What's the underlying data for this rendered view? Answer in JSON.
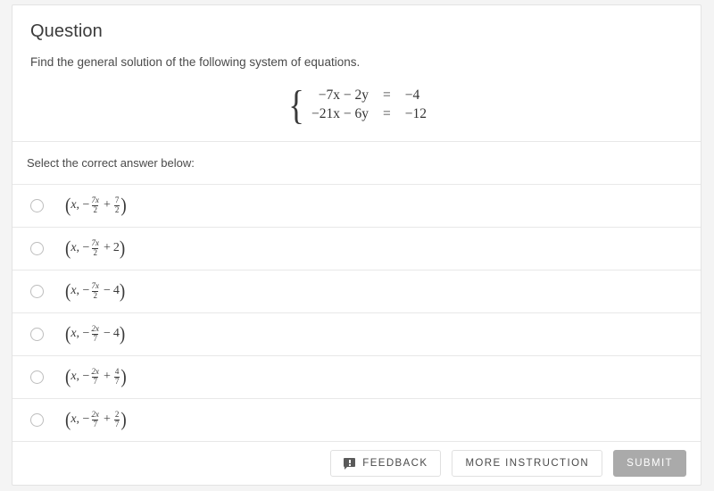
{
  "card": {
    "title": "Question",
    "prompt": "Find the general solution of the following system of equations.",
    "equations": [
      {
        "lhs": "−7x − 2y",
        "rel": "=",
        "rhs": "−4"
      },
      {
        "lhs": "−21x − 6y",
        "rel": "=",
        "rhs": "−12"
      }
    ],
    "select_prompt": "Select the correct answer below:",
    "options": [
      {
        "id": "option-1",
        "text": "(x, −7x/2 + 7/2)",
        "parts": {
          "var": "x",
          "sign": "−",
          "coef_num": "7x",
          "coef_den": "2",
          "op": "+",
          "const_num": "7",
          "const_den": "2"
        }
      },
      {
        "id": "option-2",
        "text": "(x, −7x/2 + 2)",
        "parts": {
          "var": "x",
          "sign": "−",
          "coef_num": "7x",
          "coef_den": "2",
          "op": "+",
          "const_whole": "2"
        }
      },
      {
        "id": "option-3",
        "text": "(x, −7x/2 − 4)",
        "parts": {
          "var": "x",
          "sign": "−",
          "coef_num": "7x",
          "coef_den": "2",
          "op": "−",
          "const_whole": "4"
        }
      },
      {
        "id": "option-4",
        "text": "(x, −2x/7 − 4)",
        "parts": {
          "var": "x",
          "sign": "−",
          "coef_num": "2x",
          "coef_den": "7",
          "op": "−",
          "const_whole": "4"
        }
      },
      {
        "id": "option-5",
        "text": "(x, −2x/7 + 4/7)",
        "parts": {
          "var": "x",
          "sign": "−",
          "coef_num": "2x",
          "coef_den": "7",
          "op": "+",
          "const_num": "4",
          "const_den": "7"
        }
      },
      {
        "id": "option-6",
        "text": "(x, −2x/7 + 2/7)",
        "parts": {
          "var": "x",
          "sign": "−",
          "coef_num": "2x",
          "coef_den": "7",
          "op": "+",
          "const_num": "2",
          "const_den": "7"
        }
      }
    ],
    "footer": {
      "feedback_label": "FEEDBACK",
      "feedback_icon": "comment-alert-icon",
      "more_instruction_label": "MORE INSTRUCTION",
      "submit_label": "SUBMIT",
      "submit_disabled_color": "#aaaaaa"
    }
  }
}
